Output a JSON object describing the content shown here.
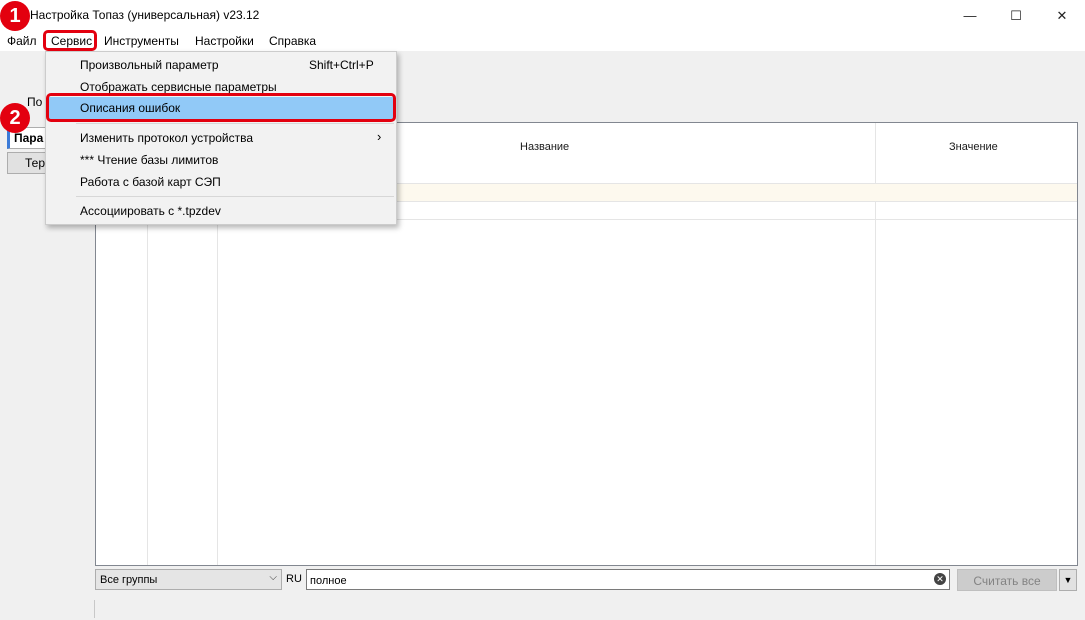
{
  "window": {
    "title": "Настройка Топаз (универсальная) v23.12",
    "minimize": "—",
    "maximize": "☐",
    "close": "✕"
  },
  "menubar": [
    "Файл",
    "Сервис",
    "Инструменты",
    "Настройки",
    "Справка"
  ],
  "dropdown": {
    "items": [
      {
        "label": "Произвольный параметр",
        "shortcut": "Shift+Ctrl+P"
      },
      {
        "label": "Отображать сервисные параметры"
      },
      {
        "label": "Описания ошибок",
        "highlighted": true
      },
      {
        "label": "Изменить протокол устройства",
        "submenu": "›"
      },
      {
        "label": "*** Чтение базы лимитов"
      },
      {
        "label": "Работа с базой карт СЭП"
      },
      {
        "label": "Ассоциировать с *.tpzdev"
      }
    ]
  },
  "left_panel": {
    "label_partial": "По",
    "tab_active": "Пара",
    "tab_inactive": "Тер"
  },
  "table": {
    "columns": [
      "",
      "",
      "Название",
      "Значение"
    ]
  },
  "bottom": {
    "group_select": "Все группы",
    "group_arrow": "⌵",
    "lang": "RU",
    "filter_value": "полное",
    "clear": "✕",
    "read_all": "Считать все",
    "split_arrow": "▼"
  },
  "annotations": {
    "badge1": "1",
    "badge2": "2",
    "accent_color": "#e3000f",
    "highlight_color": "#91c9f7"
  }
}
